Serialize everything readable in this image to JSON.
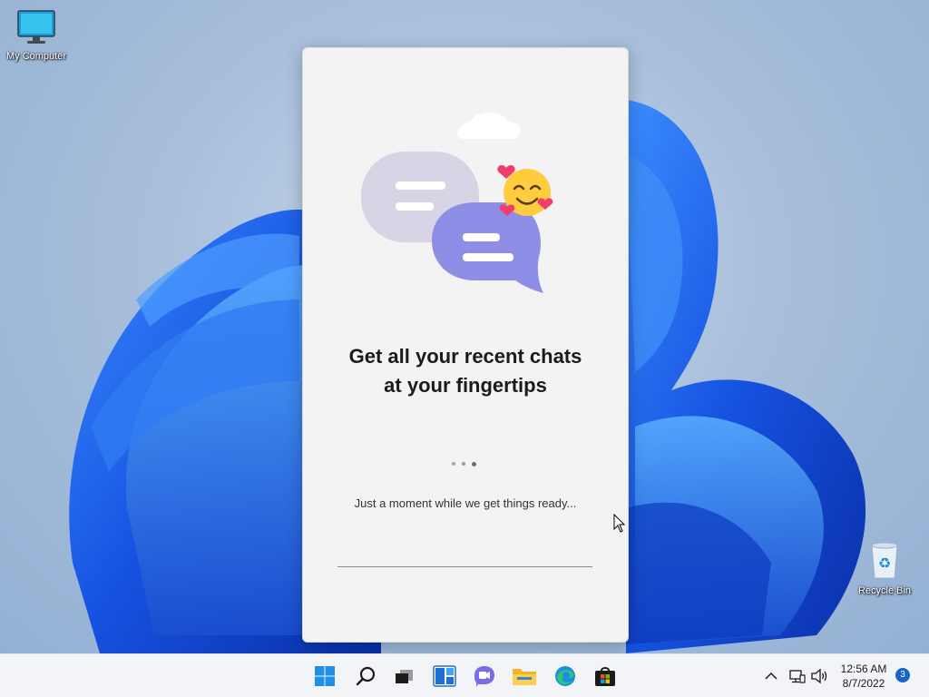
{
  "desktop": {
    "icons": [
      {
        "label": "My Computer",
        "icon": "computer-icon"
      },
      {
        "label": "Recycle Bin",
        "icon": "recycle-bin-icon"
      }
    ]
  },
  "chat_window": {
    "headline_line1": "Get all your recent chats",
    "headline_line2": "at your fingertips",
    "status_text": "Just a moment while we get things ready...",
    "illustration": [
      "cloud",
      "chat-bubbles",
      "smiling-face-with-hearts"
    ]
  },
  "taskbar": {
    "buttons": [
      "windows-start-icon",
      "search-icon",
      "task-view-icon",
      "widgets-icon",
      "chat-icon",
      "file-explorer-icon",
      "edge-browser-icon",
      "store-icon"
    ],
    "tray": {
      "chevron": "chevron-up-icon",
      "network": "network-icon",
      "volume": "volume-icon",
      "time": "12:56 AM",
      "date": "8/7/2022",
      "notification_count": "3"
    }
  },
  "colors": {
    "accent": "#1a63c7",
    "bubble_back": "#d9d3e6",
    "bubble_front": "#8f8ee6",
    "wallpaper_bloom": "#1f5fe0"
  }
}
